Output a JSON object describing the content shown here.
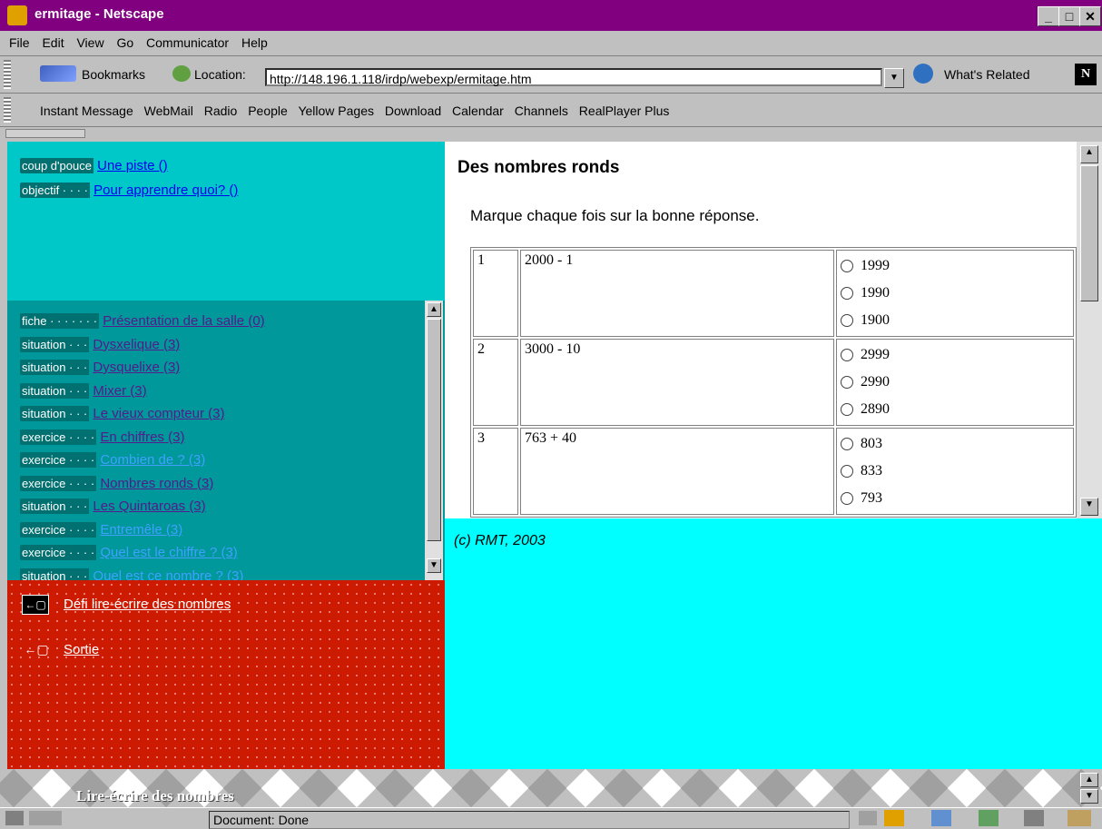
{
  "window": {
    "title": "ermitage - Netscape",
    "buttons": [
      "_",
      "▫",
      "×"
    ]
  },
  "menu": [
    "File",
    "Edit",
    "View",
    "Go",
    "Communicator",
    "Help"
  ],
  "toolbar": {
    "bookmarks": "Bookmarks",
    "location_label": "Location:",
    "url": "http://148.196.1.118/irdp/webexp/ermitage.htm",
    "whats_related": "What's Related"
  },
  "personal_toolbar": [
    "Instant Message",
    "WebMail",
    "Radio",
    "People",
    "Yellow Pages",
    "Download",
    "Calendar",
    "Channels",
    "RealPlayer Plus"
  ],
  "top_frame": {
    "rows": [
      {
        "tag": "coup d'pouce",
        "link": "Une piste ()"
      },
      {
        "tag": "objectif · · · ·",
        "link": "Pour apprendre quoi? ()"
      }
    ]
  },
  "nav_frame": {
    "rows": [
      {
        "tag": "fiche · · · · · · ·",
        "link": "Présentation de la salle (0)",
        "style": "visited"
      },
      {
        "tag": "situation · · ·",
        "link": "Dysxelique (3)",
        "style": "visited"
      },
      {
        "tag": "situation · · ·",
        "link": "Dysquelixe (3)",
        "style": "visited"
      },
      {
        "tag": "situation · · ·",
        "link": "Mixer (3)",
        "style": "visited"
      },
      {
        "tag": "situation · · ·",
        "link": "Le vieux compteur (3)",
        "style": "visited"
      },
      {
        "tag": "exercice · · · ·",
        "link": "En chiffres (3)",
        "style": "visited"
      },
      {
        "tag": "exercice · · · ·",
        "link": "Combien de ? (3)",
        "style": "lt"
      },
      {
        "tag": "exercice · · · ·",
        "link": "Nombres ronds (3)",
        "style": "visited"
      },
      {
        "tag": "situation · · ·",
        "link": "Les Quintaroas (3)",
        "style": "visited"
      },
      {
        "tag": "exercice · · · ·",
        "link": "Entremêle (3)",
        "style": "lt"
      },
      {
        "tag": "exercice · · · ·",
        "link": "Quel est le chiffre ? (3)",
        "style": "lt"
      },
      {
        "tag": "situation · · ·",
        "link": "Quel est ce nombre ? (3)",
        "style": "lt"
      }
    ]
  },
  "red_frame": {
    "link1": "Défi lire-écrire des nombres",
    "link2": "Sortie"
  },
  "content": {
    "title": "Des nombres ronds",
    "instruction": "Marque chaque fois sur la bonne réponse.",
    "questions": [
      {
        "n": "1",
        "expr": "2000 - 1",
        "options": [
          "1999",
          "1990",
          "1900"
        ]
      },
      {
        "n": "2",
        "expr": "3000 - 10",
        "options": [
          "2999",
          "2990",
          "2890"
        ]
      },
      {
        "n": "3",
        "expr": "763 + 40",
        "options": [
          "803",
          "833",
          "793"
        ]
      }
    ]
  },
  "footer": {
    "copyright": "(c) RMT, 2003"
  },
  "banner": {
    "title": "Lire-écrire des nombres"
  },
  "status": {
    "text": "Document: Done"
  }
}
